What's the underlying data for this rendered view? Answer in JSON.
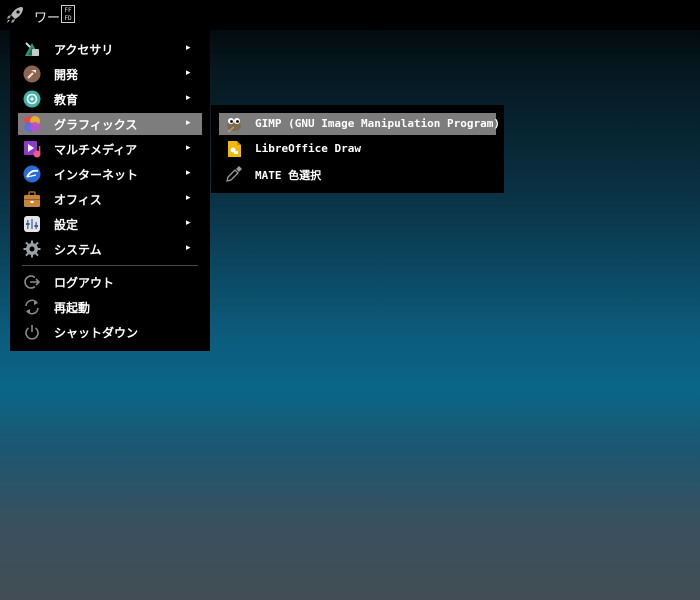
{
  "topbar": {
    "launcher_icon": "rocket-icon",
    "workspace_label": "ワー",
    "workspace_box": [
      "FF",
      "FD"
    ]
  },
  "menu": {
    "items": [
      {
        "label": "アクセサリ",
        "icon": "accessories-icon",
        "has_submenu": true
      },
      {
        "label": "開発",
        "icon": "development-icon",
        "has_submenu": true
      },
      {
        "label": "教育",
        "icon": "education-icon",
        "has_submenu": true
      },
      {
        "label": "グラフィックス",
        "icon": "graphics-icon",
        "has_submenu": true,
        "active": true
      },
      {
        "label": "マルチメディア",
        "icon": "multimedia-icon",
        "has_submenu": true
      },
      {
        "label": "インターネット",
        "icon": "internet-icon",
        "has_submenu": true
      },
      {
        "label": "オフィス",
        "icon": "office-icon",
        "has_submenu": true
      },
      {
        "label": "設定",
        "icon": "settings-icon",
        "has_submenu": true
      },
      {
        "label": "システム",
        "icon": "system-icon",
        "has_submenu": true
      }
    ],
    "session": [
      {
        "label": "ログアウト",
        "icon": "logout-icon"
      },
      {
        "label": "再起動",
        "icon": "reboot-icon"
      },
      {
        "label": "シャットダウン",
        "icon": "shutdown-icon"
      }
    ],
    "arrow": "▸"
  },
  "submenu": {
    "items": [
      {
        "label": "GIMP (GNU Image Manipulation Program)",
        "icon": "gimp-icon",
        "active": true
      },
      {
        "label": "LibreOffice Draw",
        "icon": "libreoffice-draw-icon"
      },
      {
        "label": "MATE 色選択",
        "icon": "color-picker-icon"
      }
    ]
  },
  "colors": {
    "menu_bg": "#000000",
    "highlight": "#7d7d7d"
  }
}
